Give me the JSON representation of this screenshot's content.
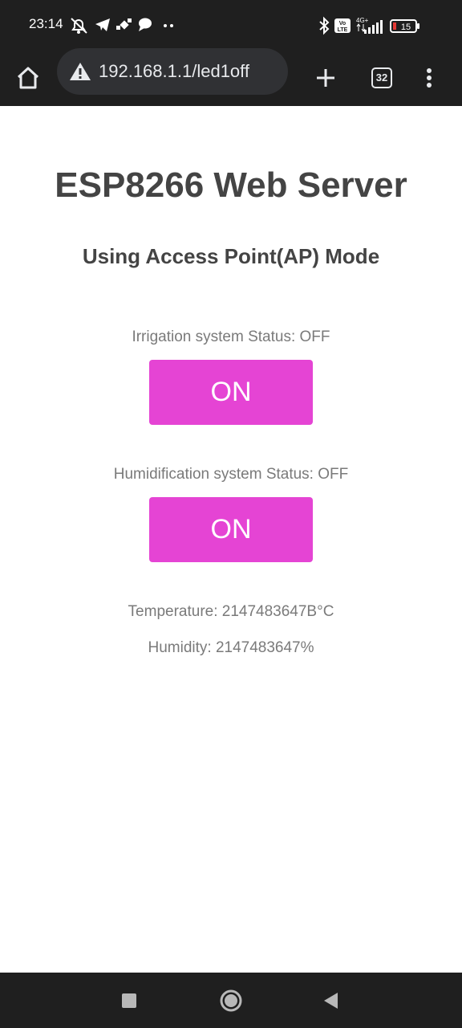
{
  "status_bar": {
    "time": "23:14",
    "left_icons": [
      "muted-notifications-icon",
      "telegram-icon",
      "satellite-icon",
      "chat-bubble-icon",
      "more-dots-icon"
    ],
    "right_icons": [
      "bluetooth-icon",
      "volte-icon",
      "signal-4g-icon",
      "battery-icon"
    ],
    "network_label": "4G+",
    "volte_label": "Vo LTE",
    "battery_level": "15",
    "battery_color": "#e53935"
  },
  "browser": {
    "url": "192.168.1.1/led1off",
    "tab_count": "32",
    "icons": [
      "home-icon",
      "not-secure-warning-icon",
      "new-tab-plus-icon",
      "tab-switcher-icon",
      "menu-kebab-icon"
    ]
  },
  "page": {
    "title": "ESP8266 Web Server",
    "subtitle": "Using Access Point(AP) Mode",
    "irrigation_status": "Irrigation system Status: OFF",
    "irrigation_button": "ON",
    "humidification_status": "Humidification system Status: OFF",
    "humidification_button": "ON",
    "temperature": "Temperature: 2147483647B°C",
    "humidity": "Humidity: 2147483647%"
  },
  "colors": {
    "button": "#e544d4",
    "heading": "#444444",
    "status_text": "#7a7a7a",
    "chrome": "#1f1f1f"
  },
  "nav_bar": {
    "icons": [
      "recent-apps-square-icon",
      "home-circle-icon",
      "back-triangle-icon"
    ]
  }
}
